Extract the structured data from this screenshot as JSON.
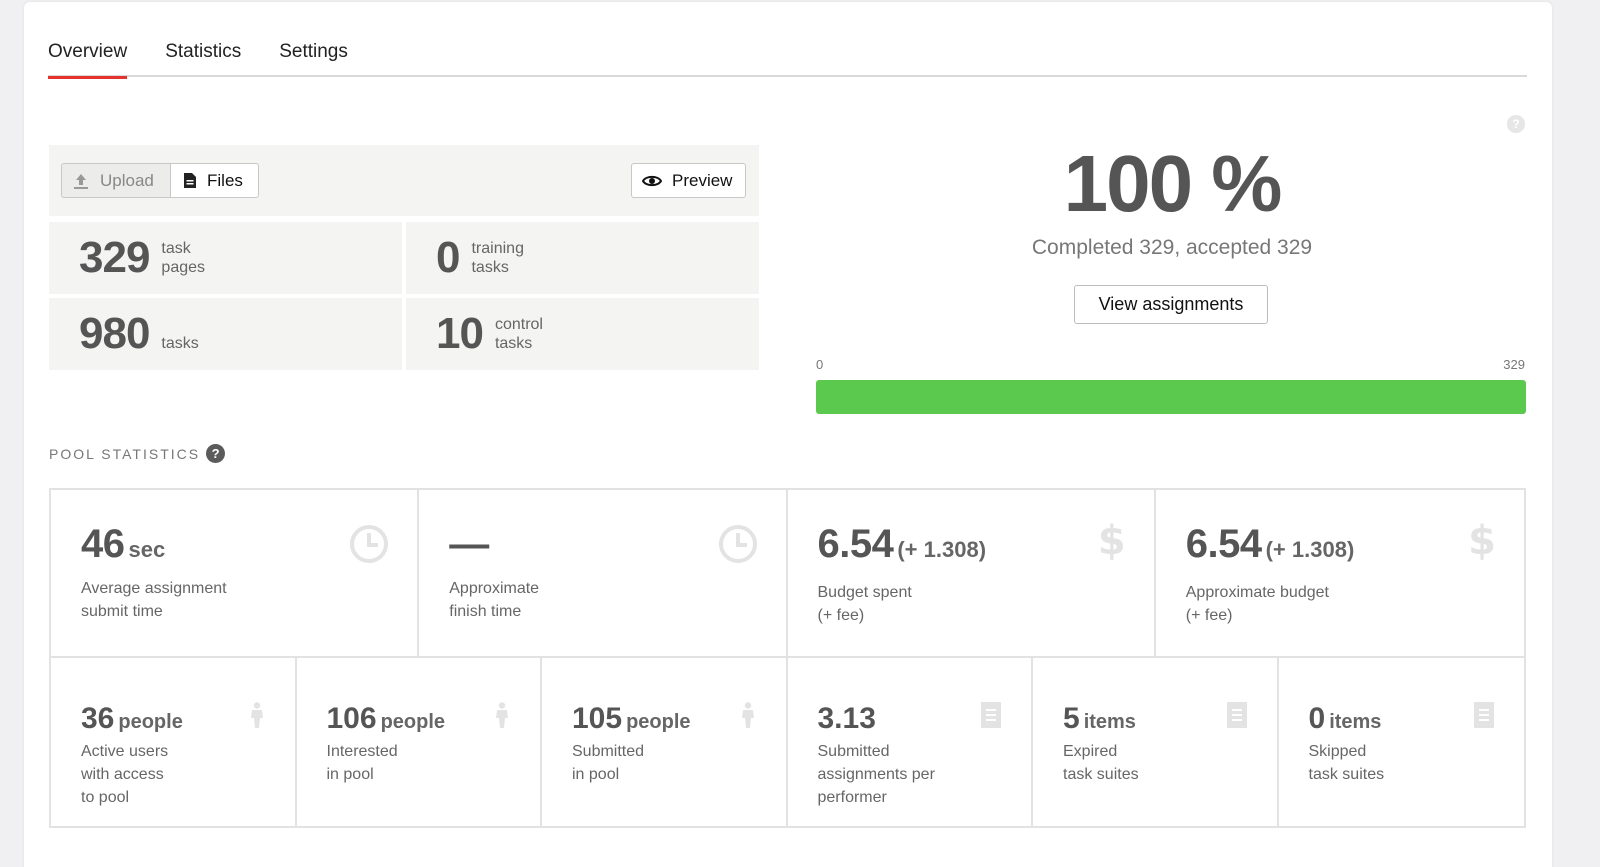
{
  "tabs": [
    {
      "label": "Overview",
      "active": true
    },
    {
      "label": "Statistics",
      "active": false
    },
    {
      "label": "Settings",
      "active": false
    }
  ],
  "toolbar": {
    "upload_label": "Upload",
    "files_label": "Files",
    "preview_label": "Preview"
  },
  "tiles": {
    "task_pages": {
      "value": "329",
      "label_1": "task",
      "label_2": "pages"
    },
    "training_tasks": {
      "value": "0",
      "label_1": "training",
      "label_2": "tasks"
    },
    "tasks": {
      "value": "980",
      "label_1": "tasks"
    },
    "control_tasks": {
      "value": "10",
      "label_1": "control",
      "label_2": "tasks"
    }
  },
  "progress": {
    "help_icon": "?",
    "percent_label": "100 %",
    "completed_text": "Completed 329, accepted 329",
    "view_button": "View assignments",
    "min_label": "0",
    "max_label": "329",
    "fill_fraction": 1.0,
    "fill_color": "#5ac94d"
  },
  "pool_statistics": {
    "title": "POOL STATISTICS",
    "help_icon": "?",
    "top": [
      {
        "value": "46",
        "unit": "sec",
        "label_1": "Average assignment",
        "label_2": "submit time",
        "icon": "clock-icon"
      },
      {
        "value": "—",
        "unit": "",
        "label_1": "Approximate",
        "label_2": "finish time",
        "icon": "clock-icon"
      },
      {
        "value": "6.54",
        "unit": "(+ 1.308)",
        "label_1": "Budget spent",
        "label_2": "(+ fee)",
        "icon": "$"
      },
      {
        "value": "6.54",
        "unit": "(+ 1.308)",
        "label_1": "Approximate budget",
        "label_2": "(+ fee)",
        "icon": "$"
      }
    ],
    "bottom": [
      {
        "value": "36",
        "unit": "people",
        "label_1": "Active users",
        "label_2": "with access",
        "label_3": "to pool",
        "icon": "person-icon"
      },
      {
        "value": "106",
        "unit": "people",
        "label_1": "Interested",
        "label_2": "in pool",
        "label_3": "",
        "icon": "person-icon"
      },
      {
        "value": "105",
        "unit": "people",
        "label_1": "Submitted",
        "label_2": "in pool",
        "label_3": "",
        "icon": "person-icon"
      },
      {
        "value": "3.13",
        "unit": "",
        "label_1": "Submitted",
        "label_2": "assignments per",
        "label_3": "performer",
        "icon": "document-icon"
      },
      {
        "value": "5",
        "unit": "items",
        "label_1": "Expired",
        "label_2": "task suites",
        "label_3": "",
        "icon": "document-icon"
      },
      {
        "value": "0",
        "unit": "items",
        "label_1": "Skipped",
        "label_2": "task suites",
        "label_3": "",
        "icon": "document-icon"
      }
    ]
  }
}
